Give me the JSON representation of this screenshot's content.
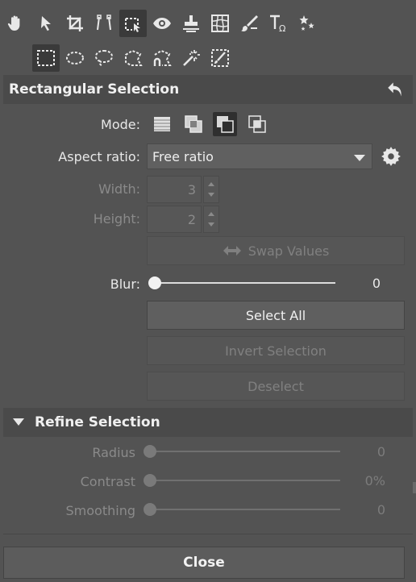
{
  "toolbar_row1": [
    {
      "name": "hand-icon"
    },
    {
      "name": "arrow-pointer-icon"
    },
    {
      "name": "crop-icon"
    },
    {
      "name": "perspective-icon"
    },
    {
      "name": "selection-tool-icon",
      "active": true
    },
    {
      "name": "eye-icon"
    },
    {
      "name": "stamp-icon"
    },
    {
      "name": "liquify-icon"
    },
    {
      "name": "brush-icon"
    },
    {
      "name": "text-icon"
    },
    {
      "name": "stars-icon"
    }
  ],
  "toolbar_row2": [
    {
      "name": "rectangle-select-icon",
      "active": true
    },
    {
      "name": "ellipse-select-icon"
    },
    {
      "name": "lasso-icon"
    },
    {
      "name": "polygon-lasso-icon"
    },
    {
      "name": "magnetic-lasso-icon"
    },
    {
      "name": "magic-wand-icon"
    },
    {
      "name": "brush-select-icon"
    }
  ],
  "panel": {
    "title": "Rectangular Selection",
    "reset_icon": "undo-arrow-icon"
  },
  "mode": {
    "label": "Mode:",
    "active_index": 2
  },
  "aspect": {
    "label": "Aspect ratio:",
    "value": "Free ratio"
  },
  "width": {
    "label": "Width:",
    "value": "3"
  },
  "height": {
    "label": "Height:",
    "value": "2"
  },
  "swap": {
    "label": "Swap Values"
  },
  "blur": {
    "label": "Blur:",
    "value": "0",
    "level": 0
  },
  "buttons": {
    "select_all": "Select All",
    "invert": "Invert Selection",
    "deselect": "Deselect"
  },
  "refine": {
    "title": "Refine Selection",
    "radius": {
      "label": "Radius",
      "value": "0",
      "level": 0
    },
    "contrast": {
      "label": "Contrast",
      "value": "0%",
      "level": 0
    },
    "smoothing": {
      "label": "Smoothing",
      "value": "0",
      "level": 0
    }
  },
  "close_label": "Close"
}
